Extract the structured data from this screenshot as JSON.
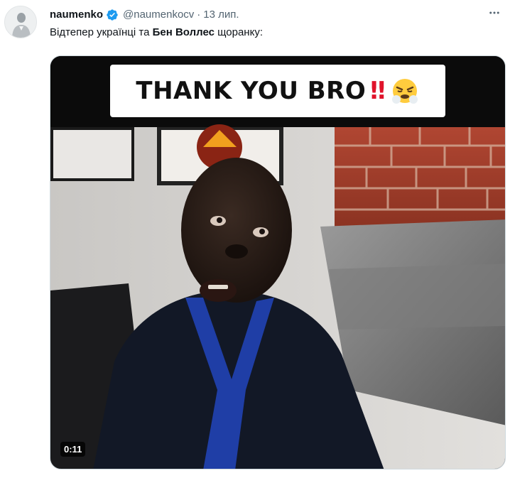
{
  "author": {
    "display_name": "naumenko",
    "handle": "@naumenkocv",
    "separator": "·",
    "date": "13 лип."
  },
  "tweet": {
    "text_before": "Відтепер українці та ",
    "text_bold": "Бен Воллес",
    "text_after": " щоранку:"
  },
  "video": {
    "caption_text": "THANK YOU BRO",
    "caption_bangs": "‼",
    "caption_emoji": "face-with-steam-icon",
    "duration": "0:11"
  },
  "icons": {
    "verified": "verified-badge-icon",
    "more": "more-options-icon",
    "avatar": "avatar"
  },
  "colors": {
    "text_primary": "#0f1419",
    "text_secondary": "#536471",
    "verified_blue": "#1d9bf0",
    "border": "#cfd9de",
    "caption_red": "#e0132b"
  }
}
